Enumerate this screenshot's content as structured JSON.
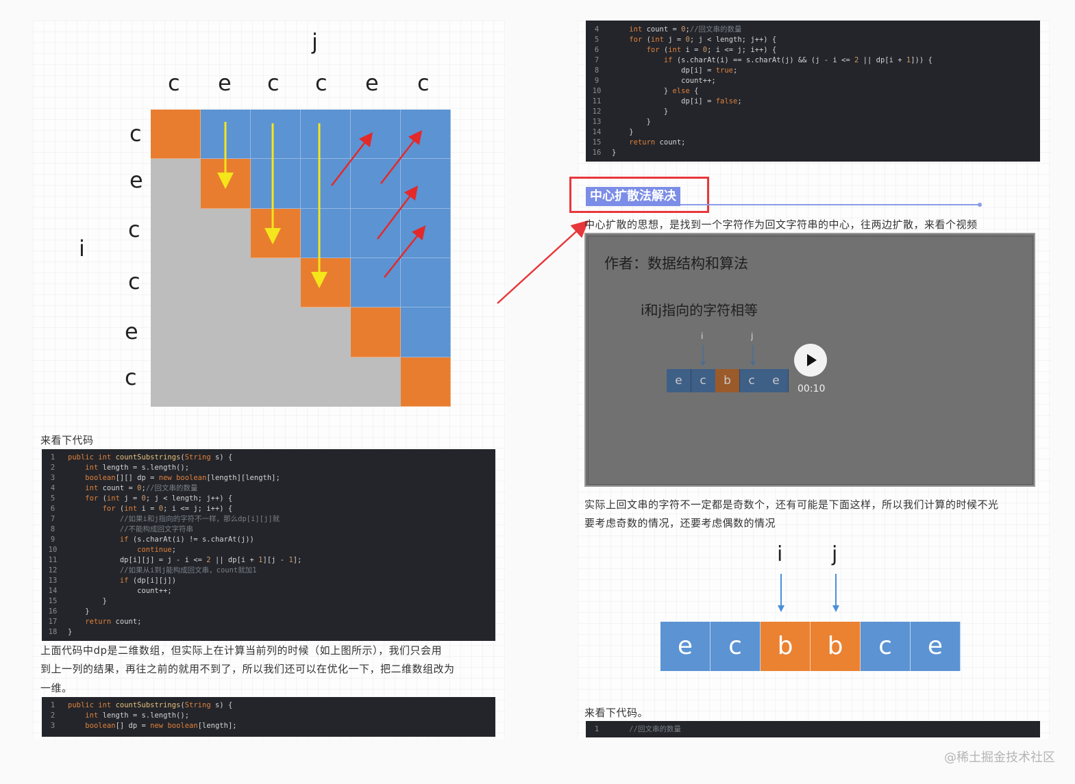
{
  "matrix": {
    "col_header": "j",
    "row_header": "i",
    "letters": [
      "c",
      "e",
      "c",
      "c",
      "e",
      "c"
    ],
    "colors": {
      "blue": "#5b93d3",
      "orange": "#e87d2f",
      "gray": "#bdbdbd",
      "yellow_arrow": "#f5e51b",
      "red_arrow": "#e32a2a"
    }
  },
  "left": {
    "intro": "来看下代码",
    "code1": [
      "public int countSubstrings(String s) {",
      "    int length = s.length();",
      "    boolean[][] dp = new boolean[length][length];",
      "    int count = 0;//回文串的数量",
      "    for (int j = 0; j < length; j++) {",
      "        for (int i = 0; i <= j; i++) {",
      "            //如果i和j指向的字符不一样，那么dp[i][j]就",
      "            //不能构成回文字符串",
      "            if (s.charAt(i) != s.charAt(j))",
      "                continue;",
      "            dp[i][j] = j - i <= 2 || dp[i + 1][j - 1];",
      "            //如果从i到j能构成回文串，count就加1",
      "            if (dp[i][j])",
      "                count++;",
      "        }",
      "    }",
      "    return count;",
      "}"
    ],
    "para_line1": "上面代码中dp是二维数组，但实际上在计算当前列的时候（如上图所示），我们只会用",
    "para_line2": "到上一列的结果，再往之前的就用不到了，所以我们还可以在优化一下，把二维数组改为",
    "para_line3": "一维。",
    "code2": [
      "public int countSubstrings(String s) {",
      "    int length = s.length();",
      "    boolean[] dp = new boolean[length];"
    ]
  },
  "right": {
    "code_top_start": 4,
    "code_top": [
      "    int count = 0;//回文串的数量",
      "    for (int j = 0; j < length; j++) {",
      "        for (int i = 0; i <= j; i++) {",
      "            if (s.charAt(i) == s.charAt(j) && (j - i <= 2 || dp[i + 1])) {",
      "                dp[i] = true;",
      "                count++;",
      "            } else {",
      "                dp[i] = false;",
      "            }",
      "        }",
      "    }",
      "    return count;",
      "}"
    ],
    "section_title": "中心扩散法解决",
    "section_desc": "中心扩散的思想，是找到一个字符作为回文字符串的中心，往两边扩散，来看个视频",
    "video": {
      "author": "作者：数据结构和算法",
      "caption": "i和j指向的字符相等",
      "pointer_i": "i",
      "pointer_j": "j",
      "letters": [
        "e",
        "c",
        "b",
        "c",
        "e"
      ],
      "highlight_index": 2,
      "time": "00:10",
      "play_icon": "play-icon"
    },
    "para_line1": "实际上回文串的字符不一定都是奇数个，还有可能是下面这样，所以我们计算的时候不光",
    "para_line2": "要考虑奇数的情况，还要考虑偶数的情况",
    "even": {
      "pointer_i": "i",
      "pointer_j": "j",
      "letters": [
        "e",
        "c",
        "b",
        "b",
        "c",
        "e"
      ],
      "highlight": [
        2,
        3
      ]
    },
    "outro": "来看下代码。",
    "code_bottom": [
      "    //回文串的数量"
    ]
  },
  "watermark": "@稀土掘金技术社区"
}
